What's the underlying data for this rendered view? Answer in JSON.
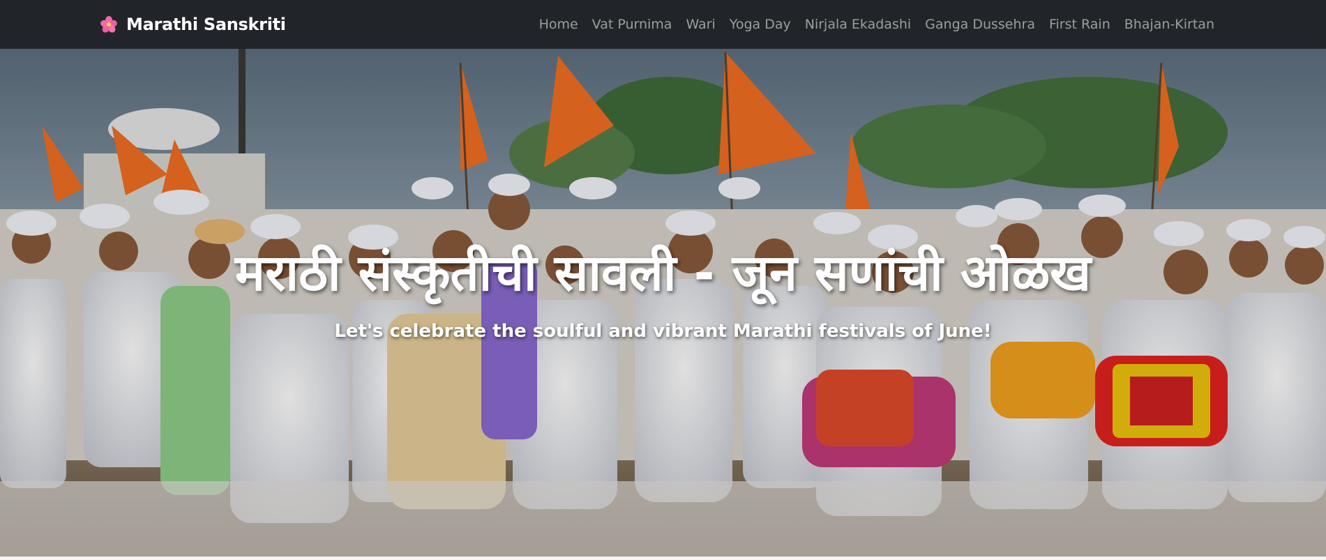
{
  "navbar": {
    "brand_icon": "hibiscus-flower-icon",
    "brand_label": "Marathi Sanskriti",
    "links": [
      {
        "label": "Home"
      },
      {
        "label": "Vat Purnima"
      },
      {
        "label": "Wari"
      },
      {
        "label": "Yoga Day"
      },
      {
        "label": "Nirjala Ekadashi"
      },
      {
        "label": "Ganga Dussehra"
      },
      {
        "label": "First Rain"
      },
      {
        "label": "Bhajan-Kirtan"
      }
    ]
  },
  "hero": {
    "title": "मराठी संस्कृतीची सावली - जून सणांची ओळख",
    "subtitle": "Let's celebrate the soulful and vibrant Marathi festivals of June!",
    "image": "wari-procession-photo"
  },
  "colors": {
    "navbar_bg": "#212529",
    "flag_saffron": "#f26f21",
    "nav_link": "rgba(255,255,255,0.55)"
  }
}
